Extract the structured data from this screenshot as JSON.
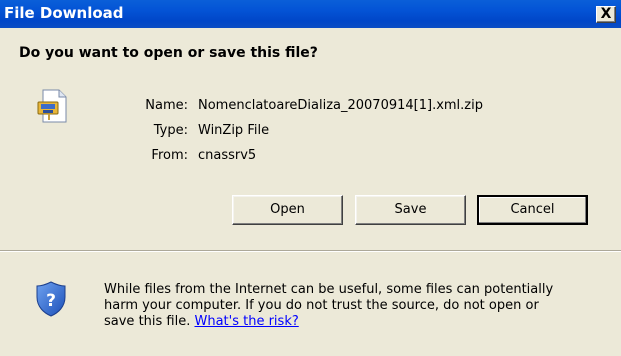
{
  "window": {
    "title": "File Download",
    "close_label": "X"
  },
  "dialog": {
    "question": "Do you want to open or save this file?",
    "file": {
      "name_label": "Name:",
      "name": "NomenclatoareDializa_20070914[1].xml.zip",
      "type_label": "Type:",
      "type": "WinZip File",
      "from_label": "From:",
      "from": "cnassrv5"
    },
    "buttons": {
      "open": "Open",
      "save": "Save",
      "cancel": "Cancel"
    },
    "warning": {
      "line1": "While files from the Internet can be useful, some files can potentially",
      "line2": "harm your computer. If you do not trust the source, do not open or",
      "line3_prefix": "save this file. ",
      "risk_link": "What's the risk?"
    }
  },
  "icons": {
    "file": "zip-file-icon",
    "security": "shield-question-icon",
    "close": "close-icon"
  },
  "colors": {
    "titlebar": "#0454d6",
    "dialog_bg": "#ece9d8",
    "link": "#0000ff"
  }
}
